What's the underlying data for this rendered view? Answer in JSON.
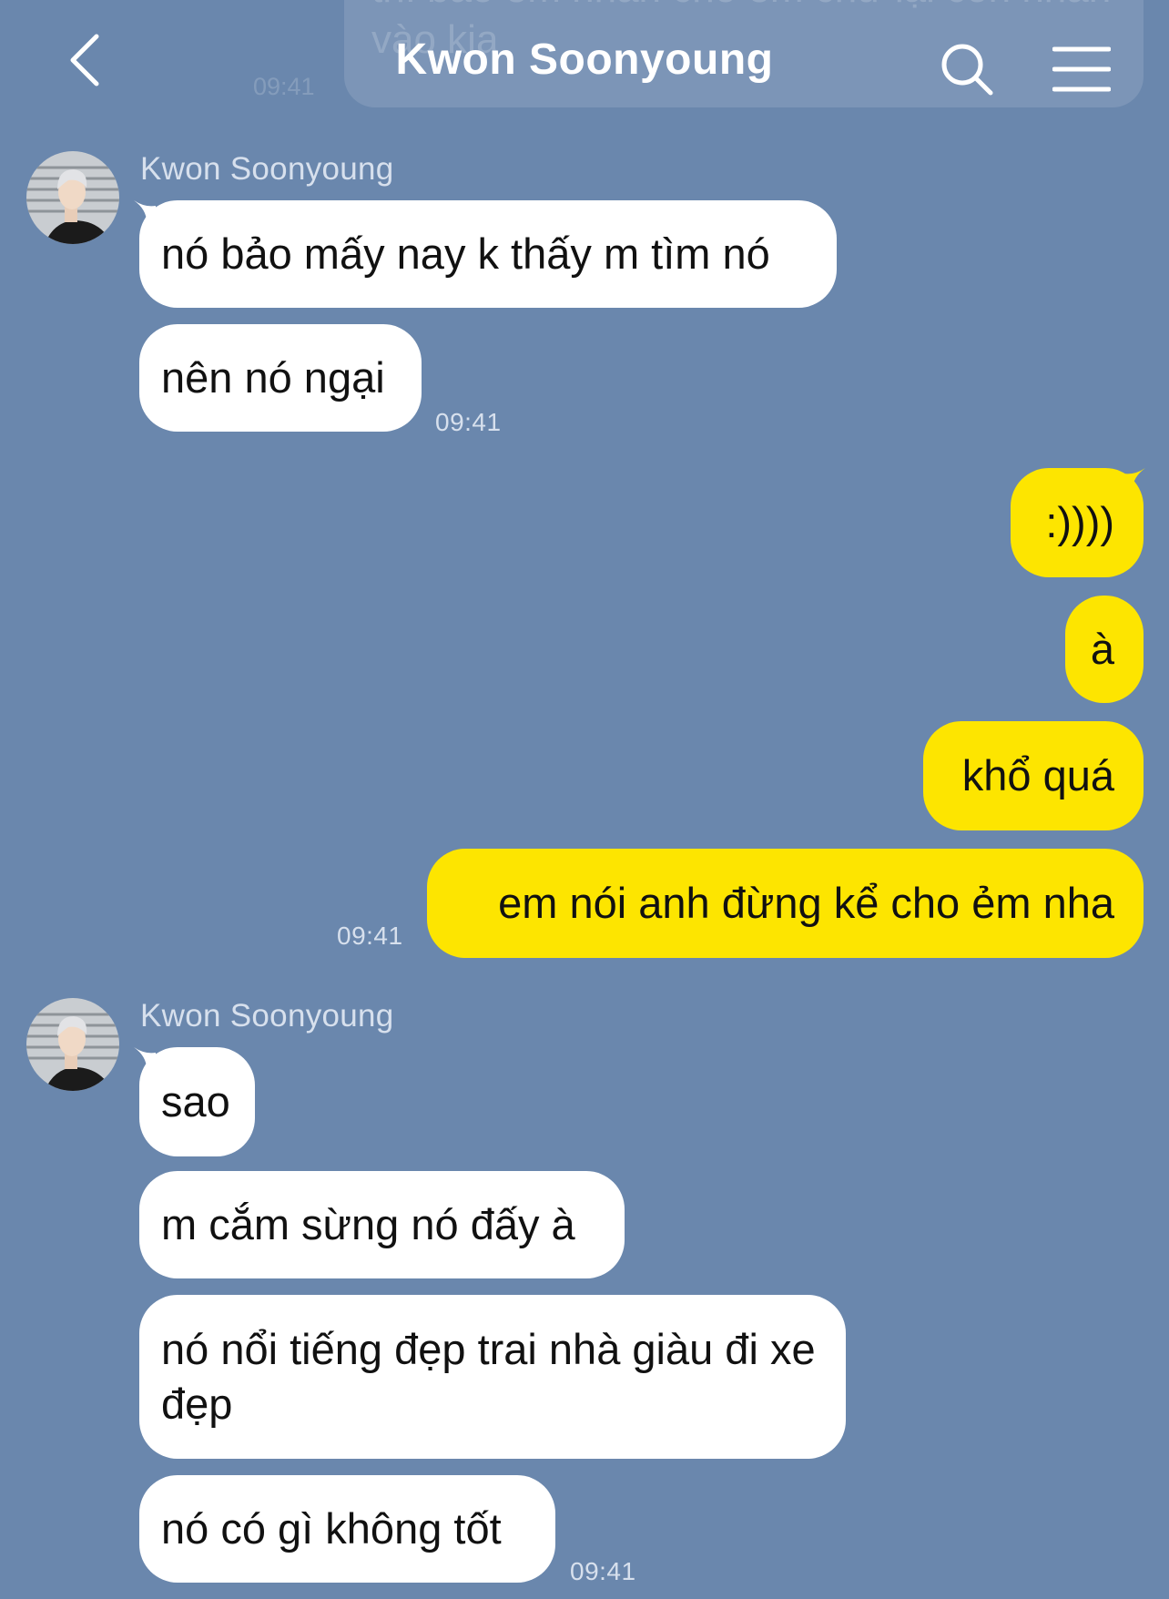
{
  "header": {
    "title": "Kwon Soonyoung",
    "ghost_text": "thì bảo em nhắn cho em chứ lại còn nhắn vào kia",
    "ghost_time": "09:41"
  },
  "colors": {
    "background": "#6a87ad",
    "incoming_bubble": "#ffffff",
    "outgoing_bubble": "#fde500"
  },
  "icons": {
    "back": "chevron-left-icon",
    "search": "search-icon",
    "menu": "hamburger-menu-icon",
    "avatar": "profile-avatar"
  },
  "messages": {
    "group1": {
      "sender": "Kwon Soonyoung",
      "m1": "nó bảo mấy nay k thấy m tìm nó",
      "m2": "nên nó ngại",
      "time": "09:41"
    },
    "group2": {
      "m1": ":))))",
      "m2": "à",
      "m3": "khổ quá",
      "m4": "em nói anh đừng kể cho ẻm nha",
      "time": "09:41"
    },
    "group3": {
      "sender": "Kwon Soonyoung",
      "m1": "sao",
      "m2": "m cắm sừng nó đấy à",
      "m3": "nó nổi tiếng đẹp trai nhà giàu đi xe đẹp",
      "m4": "nó có gì không tốt",
      "time": "09:41"
    }
  }
}
